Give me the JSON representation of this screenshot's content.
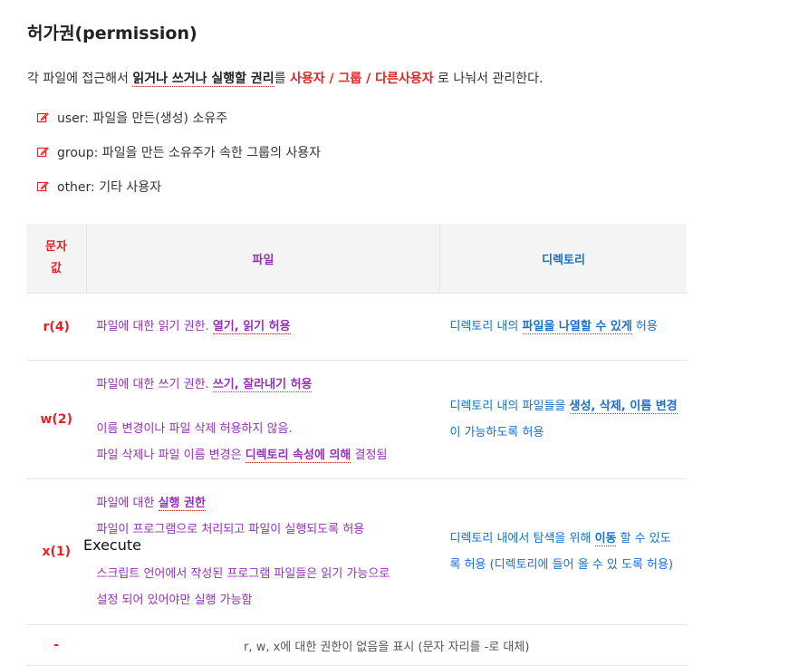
{
  "title": "허가권(permission)",
  "intro": {
    "pre": "각 파일에 접근해서 ",
    "bold": "읽거나 쓰거나 실행할 권리",
    "mid": "를 ",
    "red": "사용자 / 그룹 / 다른사용자",
    "post": " 로 나눠서 관리한다."
  },
  "list": [
    {
      "icon": "pencil-icon",
      "text": "user: 파일을 만든(생성) 소유주"
    },
    {
      "icon": "pencil-icon",
      "text": "group: 파일을 만든 소유주가 속한 그룹의 사용자"
    },
    {
      "icon": "pencil-icon",
      "text": "other: 기타 사용자"
    }
  ],
  "table": {
    "headers": {
      "col1_line1": "문자",
      "col1_line2": "값",
      "col2": "파일",
      "col3": "디렉토리"
    },
    "rows": {
      "r": {
        "code": "r(4)",
        "file_pre": "파일에 대한 읽기 권한. ",
        "file_bold": "열기, 읽기 허용",
        "dir_pre": "디렉토리 내의 ",
        "dir_bold": "파일을 나열할 수 있게",
        "dir_post": " 허용"
      },
      "w": {
        "code": "w(2)",
        "file_l1_pre": "파일에 대한 쓰기 권한. ",
        "file_l1_bold": "쓰기, 잘라내기 허용",
        "file_l2": "이름 변경이나 파일 삭제 허용하지 않음.",
        "file_l3_pre": "파일 삭제나 파일 이름 변경은 ",
        "file_l3_bold": "디렉토리 속성에 의해",
        "file_l3_post": " 결정됨",
        "dir_pre": "디렉토리 내의 파일들을 ",
        "dir_bold": "생성, 삭제, 이름 변경",
        "dir_post": "이 가능하도록 허용"
      },
      "x": {
        "code": "x(1)",
        "file_l1_pre": "파일에 대한 ",
        "file_l1_bold": "실행 권한",
        "file_l2": "파일이 프로그램으로 처리되고 파일이 실행되도록 허용",
        "file_l3": "스크립트 언어에서 작성된 프로그램 파일들은 읽기 가능으로",
        "file_l4": "설정 되어 있어야만 실행 가능함",
        "dir_pre": "디렉토리 내에서 탐색을 위해 ",
        "dir_bold": "이동",
        "dir_post": " 할 수 있도록 허용 (디렉토리에 들어 올 수 있 도록 허용)"
      },
      "dash": {
        "code": "-",
        "desc": "r, w, x에 대한 권한이 없음을 표시 (문자 자리를 -로 대체)"
      }
    }
  },
  "annotation": "Execute",
  "colors": {
    "red": "#e02424",
    "purple": "#9333b5",
    "blue": "#1a6fd1"
  }
}
